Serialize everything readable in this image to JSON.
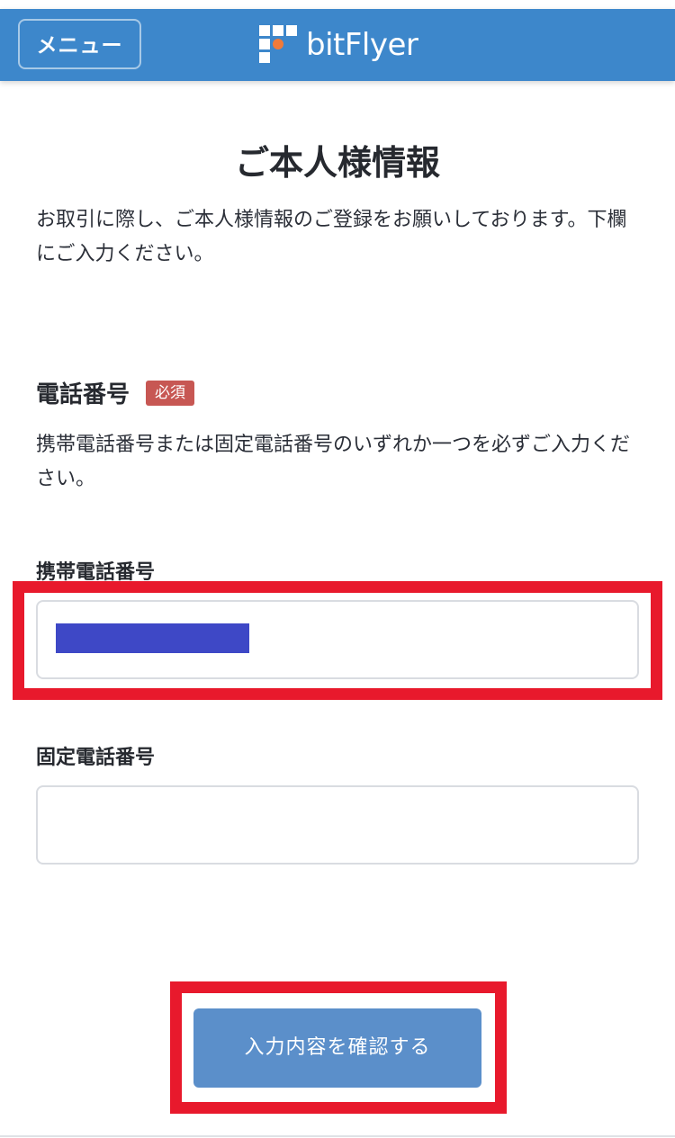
{
  "header": {
    "menu_label": "メニュー",
    "logo_text": "bitFlyer",
    "brand_color": "#3d87cb",
    "logo_accent_color": "#f07a3a"
  },
  "page": {
    "title": "ご本人様情報",
    "intro": "お取引に際し、ご本人様情報のご登録をお願いしております。下欄にご入力ください。"
  },
  "phone_section": {
    "title": "電話番号",
    "required_badge": "必須",
    "description": "携帯電話番号または固定電話番号のいずれか一つを必ずご入力ください。",
    "mobile": {
      "label": "携帯電話番号",
      "value": "",
      "redacted": true
    },
    "landline": {
      "label": "固定電話番号",
      "value": ""
    }
  },
  "actions": {
    "confirm_label": "入力内容を確認する"
  },
  "annotation": {
    "highlight_color": "#e8192c"
  }
}
